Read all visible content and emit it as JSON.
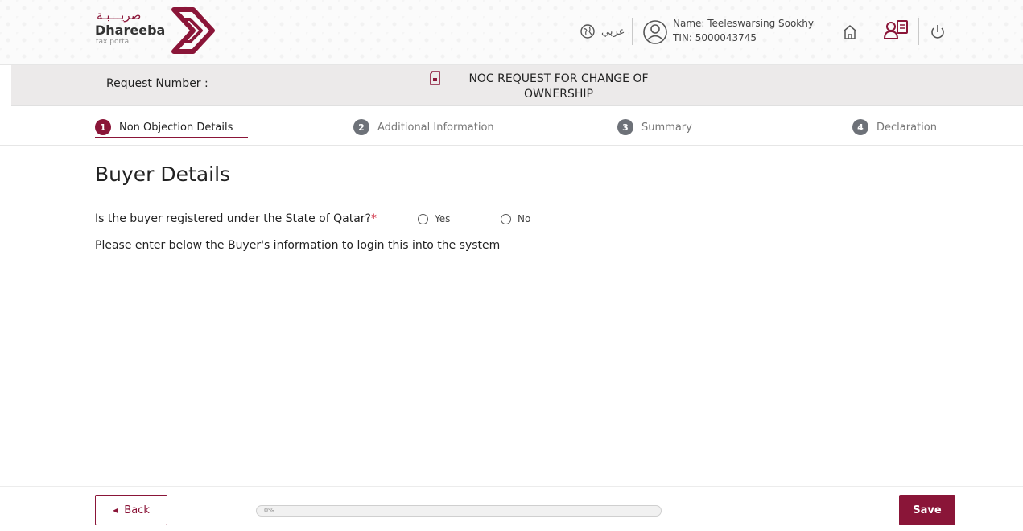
{
  "header": {
    "logo_arabic": "ضريـــبـة",
    "logo_name": "Dhareeba",
    "logo_sub": "tax portal",
    "language_link": "عربي",
    "user_name": "Name: Teeleswarsing Sookhy",
    "user_tin": "TIN: 5000043745",
    "icons": [
      "globe-icon",
      "user-avatar-icon",
      "home-icon",
      "users-icon",
      "power-icon"
    ]
  },
  "request": {
    "label": "Request Number :",
    "title": "NOC REQUEST FOR CHANGE OF OWNERSHIP"
  },
  "steps": [
    {
      "number": "1",
      "label": "Non Objection Details",
      "active": true
    },
    {
      "number": "2",
      "label": "Additional Information",
      "active": false
    },
    {
      "number": "3",
      "label": "Summary",
      "active": false
    },
    {
      "number": "4",
      "label": "Declaration",
      "active": false
    }
  ],
  "form": {
    "title": "Buyer Details",
    "question": "Is the buyer registered under the State of Qatar?",
    "required_mark": "*",
    "options": [
      "Yes",
      "No"
    ],
    "info": "Please enter below the Buyer's information to login this into the system"
  },
  "footer": {
    "back_label": "Back",
    "progress_text": "0%",
    "progress_value": 0,
    "save_label": "Save"
  },
  "colors": {
    "brand": "#8a1538",
    "step_inactive": "#6d7178",
    "bar_bg": "#eceaea"
  }
}
